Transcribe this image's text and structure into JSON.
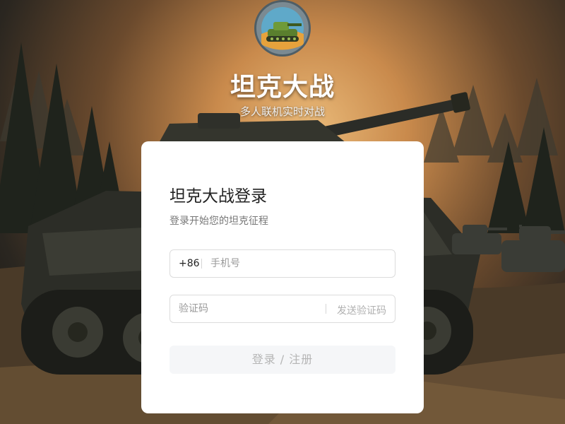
{
  "header": {
    "logo_icon": "tank-logo-icon",
    "title": "坦克大战",
    "subtitle": "多人联机实时对战"
  },
  "login_card": {
    "title": "坦克大战登录",
    "subtitle": "登录开始您的坦克征程",
    "phone": {
      "country_code": "+86",
      "placeholder": "手机号",
      "value": ""
    },
    "code": {
      "placeholder": "验证码",
      "value": "",
      "send_label": "发送验证码"
    },
    "submit_label": "登录 / 注册"
  },
  "colors": {
    "card_bg": "#ffffff",
    "title_text": "#222222",
    "muted_text": "#777777",
    "button_bg": "#f5f6f8",
    "button_text": "#b5b5b5"
  }
}
